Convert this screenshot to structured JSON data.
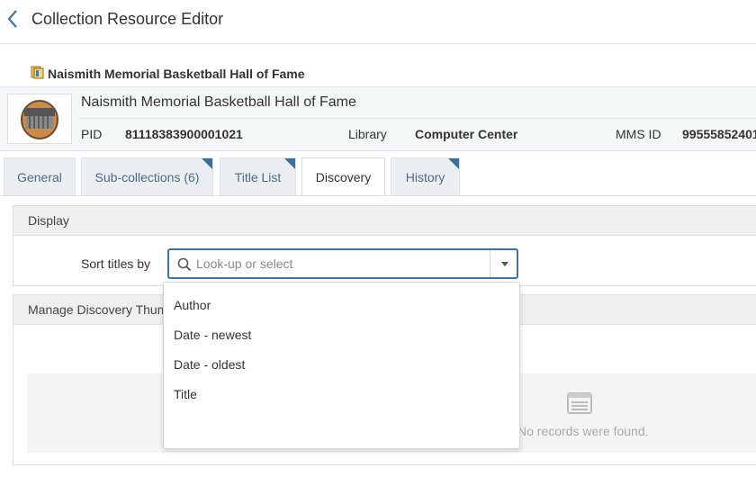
{
  "header": {
    "title": "Collection Resource Editor"
  },
  "record": {
    "small_title": "Naismith Memorial Basketball Hall of Fame",
    "title": "Naismith Memorial Basketball Hall of Fame",
    "pid_label": "PID",
    "pid_value": "81118383900001021",
    "library_label": "Library",
    "library_value": "Computer Center",
    "mms_label": "MMS ID",
    "mms_value": "99555852401"
  },
  "tabs": [
    {
      "label": "General"
    },
    {
      "label": "Sub-collections (6)"
    },
    {
      "label": "Title List"
    },
    {
      "label": "Discovery"
    },
    {
      "label": "History"
    }
  ],
  "display_section": {
    "title": "Display",
    "sort_label": "Sort titles by",
    "placeholder": "Look-up or select",
    "options": [
      "Author",
      "Date - newest",
      "Date - oldest",
      "Title"
    ]
  },
  "thumb_section": {
    "title": "Manage Discovery Thum",
    "empty_text": "No records were found."
  },
  "colors": {
    "accent": "#3b74a8",
    "tab_link": "#4a6a88",
    "corner": "#3d6e9c"
  },
  "icons": [
    "back-arrow-icon",
    "collection-icon",
    "search-icon",
    "chevron-down-icon",
    "list-icon"
  ]
}
